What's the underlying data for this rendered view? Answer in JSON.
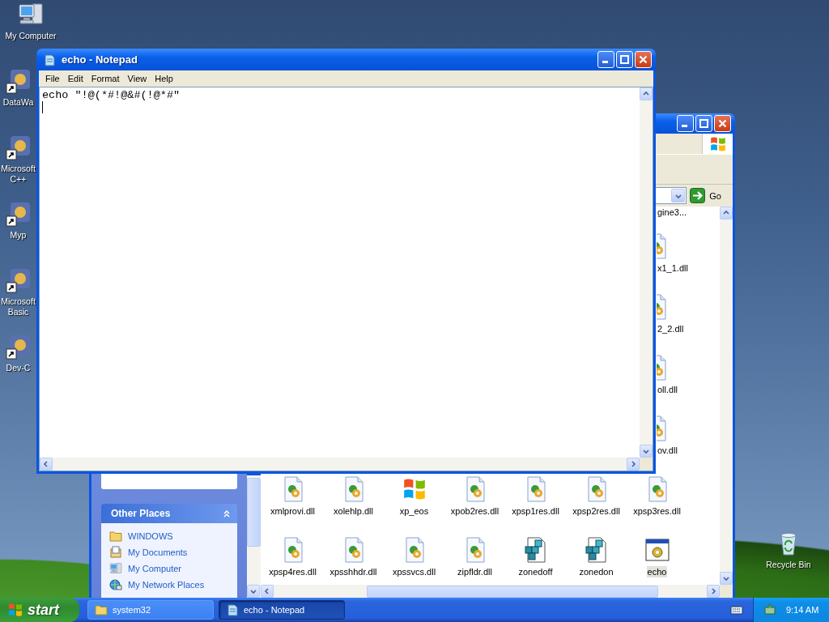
{
  "desktop_icons": [
    {
      "label": "My Computer",
      "kind": "computer"
    },
    {
      "label": "DataWa",
      "kind": "shortcut"
    },
    {
      "label": "Microsoft C++",
      "kind": "shortcut"
    },
    {
      "label": "Myp",
      "kind": "shortcut"
    },
    {
      "label": "Microsoft Basic",
      "kind": "shortcut"
    },
    {
      "label": "Dev-C",
      "kind": "shortcut"
    }
  ],
  "recycle_bin": {
    "label": "Recycle Bin"
  },
  "explorer": {
    "address_go": "Go",
    "task_pane": {
      "title": "Other Places",
      "items": [
        {
          "label": "WINDOWS",
          "kind": "folder"
        },
        {
          "label": "My Documents",
          "kind": "documents"
        },
        {
          "label": "My Computer",
          "kind": "computer"
        },
        {
          "label": "My Network Places",
          "kind": "network"
        }
      ]
    },
    "files_partial": [
      {
        "name": "gine3...",
        "kind": "none"
      },
      {
        "name": "x1_1.dll",
        "kind": "dll"
      },
      {
        "name": "2_2.dll",
        "kind": "dll"
      },
      {
        "name": "oll.dll",
        "kind": "dll"
      },
      {
        "name": "ov.dll",
        "kind": "dll"
      }
    ],
    "files": [
      {
        "name": "xmlprovi.dll",
        "kind": "dll",
        "selected": false
      },
      {
        "name": "xolehlp.dll",
        "kind": "dll",
        "selected": false
      },
      {
        "name": "xp_eos",
        "kind": "logo",
        "selected": false
      },
      {
        "name": "xpob2res.dll",
        "kind": "dll",
        "selected": false
      },
      {
        "name": "xpsp1res.dll",
        "kind": "dll",
        "selected": false
      },
      {
        "name": "xpsp2res.dll",
        "kind": "dll",
        "selected": false
      },
      {
        "name": "xpsp3res.dll",
        "kind": "dll",
        "selected": false
      },
      {
        "name": "xpsp4res.dll",
        "kind": "dll",
        "selected": false
      },
      {
        "name": "xpsshhdr.dll",
        "kind": "dll",
        "selected": false
      },
      {
        "name": "xpssvcs.dll",
        "kind": "dll",
        "selected": false
      },
      {
        "name": "zipfldr.dll",
        "kind": "dll",
        "selected": false
      },
      {
        "name": "zonedoff",
        "kind": "registry",
        "selected": false
      },
      {
        "name": "zonedon",
        "kind": "registry",
        "selected": false
      },
      {
        "name": "echo",
        "kind": "app",
        "selected": true
      }
    ]
  },
  "notepad": {
    "title": "echo - Notepad",
    "menu": [
      "File",
      "Edit",
      "Format",
      "View",
      "Help"
    ],
    "text": "echo \"!@(*#!@&#(!@*#\""
  },
  "taskbar": {
    "start": "start",
    "tasks": [
      {
        "label": "system32",
        "kind": "folder",
        "selected": false
      },
      {
        "label": "echo - Notepad",
        "kind": "notepad",
        "selected": true
      }
    ],
    "clock": "9:14 AM"
  }
}
